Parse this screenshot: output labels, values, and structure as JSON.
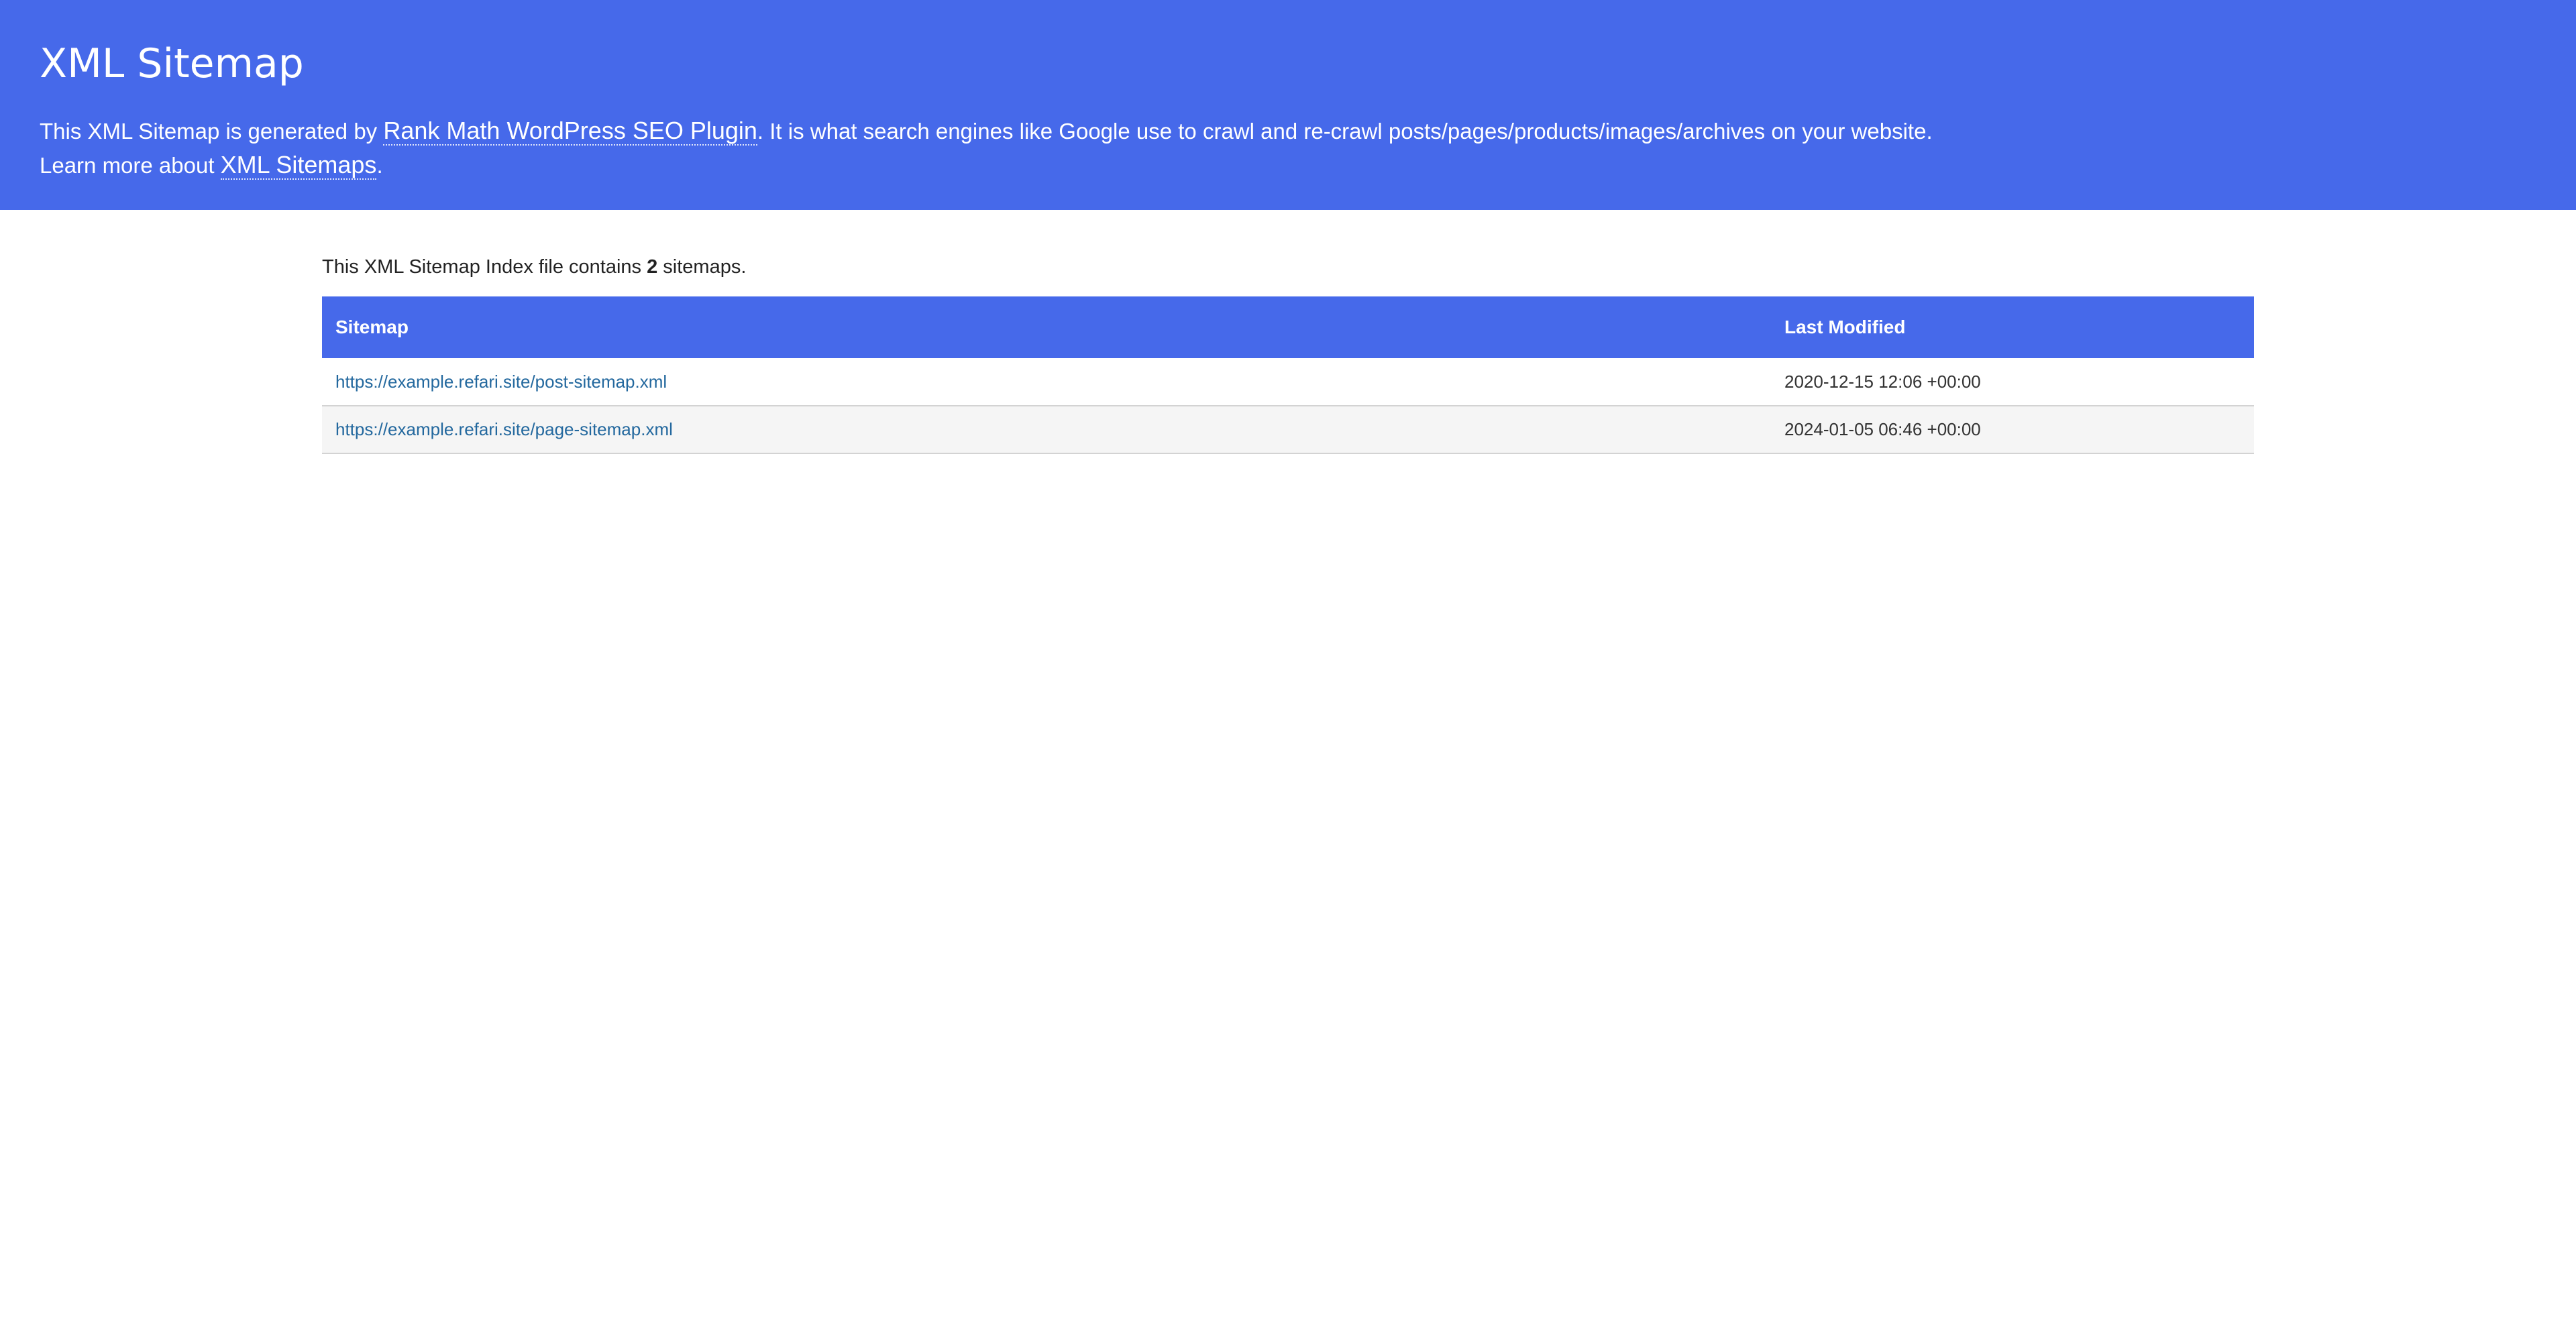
{
  "header": {
    "title": "XML Sitemap",
    "intro_before": "This XML Sitemap is generated by ",
    "plugin_link": "Rank Math WordPress SEO Plugin",
    "intro_after": ". It is what search engines like Google use to crawl and re-crawl posts/pages/products/images/archives on your website.",
    "learn_before": "Learn more about ",
    "learn_link": "XML Sitemaps",
    "learn_after": "."
  },
  "summary": {
    "before": "This XML Sitemap Index file contains ",
    "count": "2",
    "after": " sitemaps."
  },
  "table": {
    "columns": [
      "Sitemap",
      "Last Modified"
    ],
    "rows": [
      {
        "sitemap": "https://example.refari.site/post-sitemap.xml",
        "last_modified": "2020-12-15 12:06 +00:00"
      },
      {
        "sitemap": "https://example.refari.site/page-sitemap.xml",
        "last_modified": "2024-01-05 06:46 +00:00"
      }
    ]
  },
  "colors": {
    "header_bg": "#4669ea",
    "link": "#23689e",
    "row_alt": "#f5f5f5",
    "row_border": "#d3d3d3"
  }
}
